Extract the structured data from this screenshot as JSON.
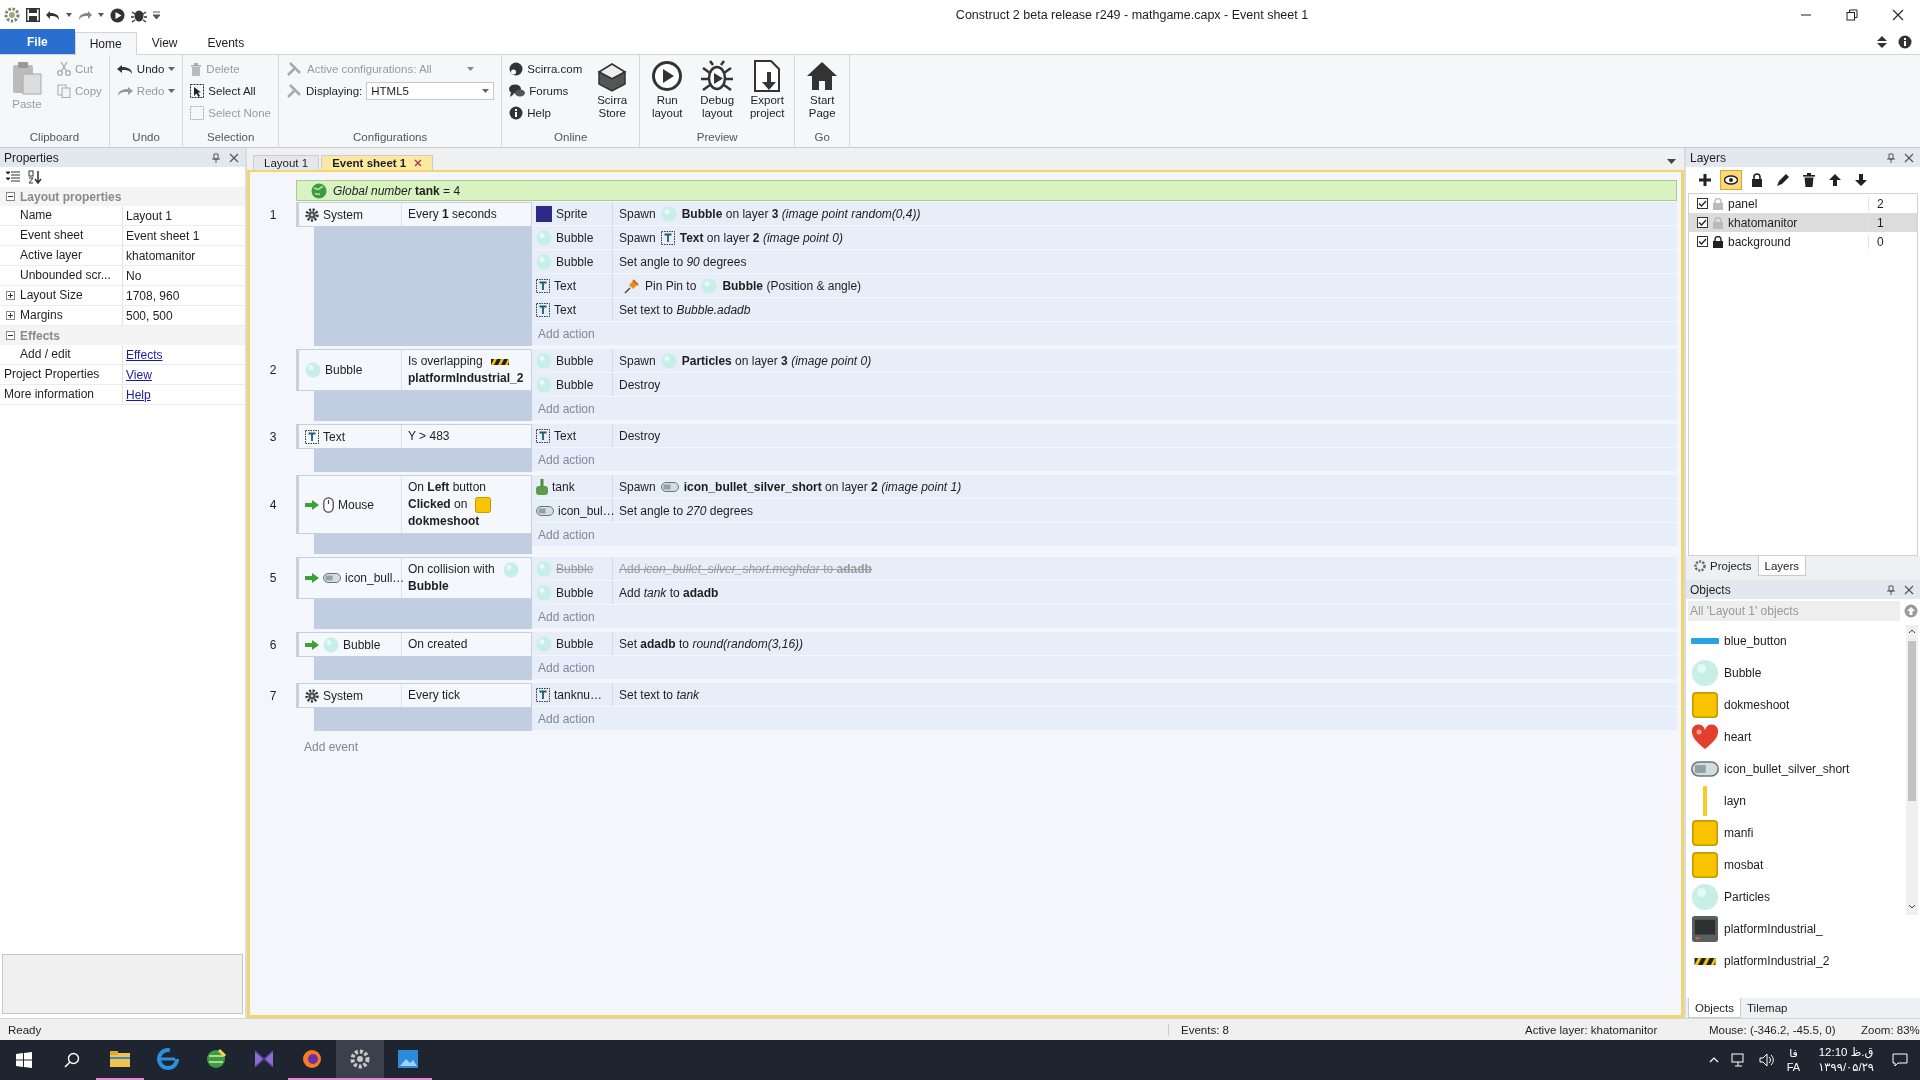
{
  "window": {
    "title": "Construct 2 beta release r249 - mathgame.capx - Event sheet 1"
  },
  "ribbon_tabs": [
    {
      "label": "File",
      "kind": "file",
      "selected": false
    },
    {
      "label": "Home",
      "kind": "tab",
      "selected": true
    },
    {
      "label": "View",
      "kind": "tab",
      "selected": false
    },
    {
      "label": "Events",
      "kind": "tab",
      "selected": false
    }
  ],
  "ribbon_groups": [
    {
      "label": "Clipboard",
      "buttons": [
        {
          "kind": "big",
          "label": "Paste",
          "disabled": true
        },
        {
          "kind": "small",
          "label": "Cut",
          "disabled": true
        },
        {
          "kind": "small",
          "label": "Copy",
          "disabled": true
        }
      ]
    },
    {
      "label": "Undo",
      "buttons": [
        {
          "kind": "split",
          "label": "Undo",
          "disabled": false
        },
        {
          "kind": "split",
          "label": "Redo",
          "disabled": true
        }
      ]
    },
    {
      "label": "Selection",
      "buttons": [
        {
          "kind": "small",
          "label": "Delete",
          "disabled": true
        },
        {
          "kind": "small",
          "label": "Select All",
          "disabled": false
        },
        {
          "kind": "small",
          "label": "Select None",
          "disabled": true
        }
      ]
    },
    {
      "label": "Configurations",
      "buttons": [
        {
          "kind": "combo",
          "label": "Active configurations: All",
          "disabled": true
        },
        {
          "kind": "select",
          "label": "Displaying:",
          "value": "HTML5",
          "disabled": false
        }
      ]
    },
    {
      "label": "Online",
      "buttons": [
        {
          "kind": "small",
          "label": "Scirra.com",
          "disabled": false
        },
        {
          "kind": "small",
          "label": "Forums",
          "disabled": false
        },
        {
          "kind": "small",
          "label": "Help",
          "disabled": false
        },
        {
          "kind": "big",
          "label": "Scirra Store",
          "disabled": false
        }
      ]
    },
    {
      "label": "Preview",
      "buttons": [
        {
          "kind": "big",
          "label": "Run layout",
          "disabled": false
        },
        {
          "kind": "big",
          "label": "Debug layout",
          "disabled": false
        },
        {
          "kind": "big",
          "label": "Export project",
          "disabled": false
        }
      ]
    },
    {
      "label": "Go",
      "buttons": [
        {
          "kind": "big",
          "label": "Start Page",
          "disabled": false
        }
      ]
    }
  ],
  "properties": {
    "title": "Properties",
    "sections": [
      {
        "title": "Layout properties",
        "expanded": true,
        "rows": [
          {
            "kind": "value",
            "name": "Name",
            "value": "Layout 1"
          },
          {
            "kind": "value",
            "name": "Event sheet",
            "value": "Event sheet 1"
          },
          {
            "kind": "value",
            "name": "Active layer",
            "value": "khatomanitor"
          },
          {
            "kind": "value",
            "name": "Unbounded scr...",
            "value": "No"
          },
          {
            "kind": "group",
            "name": "Layout Size",
            "value": "1708, 960",
            "expanded": false
          },
          {
            "kind": "group",
            "name": "Margins",
            "value": "500, 500",
            "expanded": false
          }
        ]
      },
      {
        "title": "Effects",
        "expanded": true,
        "rows": [
          {
            "kind": "link",
            "name": "Add / edit",
            "value": "Effects"
          }
        ]
      }
    ],
    "links": [
      {
        "name": "Project Properties",
        "value": "View"
      },
      {
        "name": "More information",
        "value": "Help"
      }
    ]
  },
  "doc_tabs": [
    {
      "label": "Layout 1",
      "selected": false,
      "closable": false
    },
    {
      "label": "Event sheet 1",
      "selected": true,
      "closable": true
    }
  ],
  "event_sheet": {
    "global": "*Global number* **tank** = 4",
    "events": [
      {
        "number": "1",
        "conditions": [
          {
            "kind": "system",
            "object": "System",
            "trigger": false,
            "parts": [
              {
                "text": "Every **1** seconds"
              }
            ]
          }
        ],
        "actions": [
          {
            "kind": "sprite",
            "object": "Sprite",
            "disabled": false,
            "parts": [
              {
                "text": "Spawn"
              },
              {
                "kind": "bubble"
              },
              {
                "text": "**Bubble** on layer **3** *(image point random(0,4))*"
              }
            ]
          },
          {
            "kind": "bubble",
            "object": "Bubble",
            "disabled": false,
            "parts": [
              {
                "text": "Spawn"
              },
              {
                "kind": "text"
              },
              {
                "text": "**Text** on layer **2** *(image point 0)*"
              }
            ]
          },
          {
            "kind": "bubble",
            "object": "Bubble",
            "disabled": false,
            "parts": [
              {
                "text": "Set angle to *90* degrees"
              }
            ]
          },
          {
            "kind": "text",
            "object": "Text",
            "disabled": false,
            "parts": [
              {
                "kind": "pin"
              },
              {
                "text": "Pin Pin to"
              },
              {
                "kind": "bubble"
              },
              {
                "text": "**Bubble** (Position & angle)"
              }
            ]
          },
          {
            "kind": "text",
            "object": "Text",
            "disabled": false,
            "parts": [
              {
                "text": "Set text to *Bubble.adadb*"
              }
            ]
          }
        ],
        "add_action": "Add action"
      },
      {
        "number": "2",
        "conditions": [
          {
            "kind": "bubble",
            "object": "Bubble",
            "trigger": false,
            "parts": [
              {
                "text": "Is overlapping"
              },
              {
                "kind": "stripe"
              },
              {
                "text": "**platformIndustrial_2**"
              }
            ]
          }
        ],
        "actions": [
          {
            "kind": "bubble",
            "object": "Bubble",
            "disabled": false,
            "parts": [
              {
                "text": "Spawn"
              },
              {
                "kind": "bubble"
              },
              {
                "text": "**Particles** on layer **3** *(image point 0)*"
              }
            ]
          },
          {
            "kind": "bubble",
            "object": "Bubble",
            "disabled": false,
            "parts": [
              {
                "text": "Destroy"
              }
            ]
          }
        ],
        "add_action": "Add action"
      },
      {
        "number": "3",
        "conditions": [
          {
            "kind": "text",
            "object": "Text",
            "trigger": false,
            "parts": [
              {
                "text": "Y > 483"
              }
            ]
          }
        ],
        "actions": [
          {
            "kind": "text",
            "object": "Text",
            "disabled": false,
            "parts": [
              {
                "text": "Destroy"
              }
            ]
          }
        ],
        "add_action": "Add action"
      },
      {
        "number": "4",
        "conditions": [
          {
            "kind": "mouse",
            "object": "Mouse",
            "trigger": true,
            "parts": [
              {
                "text": "On **Left** button"
              },
              {
                "text": "**Clicked** on"
              },
              {
                "kind": "block"
              },
              {
                "text": "**dokmeshoot**"
              }
            ]
          }
        ],
        "actions": [
          {
            "kind": "tank",
            "object": "tank",
            "disabled": false,
            "parts": [
              {
                "text": "Spawn"
              },
              {
                "kind": "bullet"
              },
              {
                "text": "**icon_bullet_silver_short** on layer **2** *(image point 1)*"
              }
            ]
          },
          {
            "kind": "bullet",
            "object": "icon_bul…",
            "disabled": false,
            "parts": [
              {
                "text": "Set angle to *270* degrees"
              }
            ]
          }
        ],
        "add_action": "Add action"
      },
      {
        "number": "5",
        "conditions": [
          {
            "kind": "bullet",
            "object": "icon_bull…",
            "trigger": true,
            "parts": [
              {
                "text": "On collision with"
              },
              {
                "kind": "bubble"
              },
              {
                "text": "**Bubble**"
              }
            ]
          }
        ],
        "actions": [
          {
            "kind": "bubble",
            "object": "Bubble",
            "disabled": true,
            "parts": [
              {
                "text": "Add *icon_bullet_silver_short.meghdar* to **adadb**"
              }
            ]
          },
          {
            "kind": "bubble",
            "object": "Bubble",
            "disabled": false,
            "parts": [
              {
                "text": "Add *tank* to **adadb**"
              }
            ]
          }
        ],
        "add_action": "Add action"
      },
      {
        "number": "6",
        "conditions": [
          {
            "kind": "bubble",
            "object": "Bubble",
            "trigger": true,
            "parts": [
              {
                "text": "On created"
              }
            ]
          }
        ],
        "actions": [
          {
            "kind": "bubble",
            "object": "Bubble",
            "disabled": false,
            "parts": [
              {
                "text": "Set **adadb** to *round(random(3,16))*"
              }
            ]
          }
        ],
        "add_action": "Add action"
      },
      {
        "number": "7",
        "conditions": [
          {
            "kind": "system",
            "object": "System",
            "trigger": false,
            "parts": [
              {
                "text": "Every tick"
              }
            ]
          }
        ],
        "actions": [
          {
            "kind": "text",
            "object": "tanknu…",
            "disabled": false,
            "parts": [
              {
                "text": "Set text to *tank*"
              }
            ]
          }
        ],
        "add_action": "Add action"
      }
    ],
    "add_event": "Add event"
  },
  "layers_panel": {
    "title": "Layers",
    "tools": [
      {
        "on": false
      },
      {
        "on": true
      },
      {
        "on": false
      },
      {
        "on": false
      },
      {
        "on": false
      },
      {
        "on": false
      },
      {
        "on": false
      }
    ],
    "layers": [
      {
        "name": "panel",
        "number": "2",
        "visible": true,
        "locked": false,
        "selected": false
      },
      {
        "name": "khatomanitor",
        "number": "1",
        "visible": true,
        "locked": false,
        "selected": true
      },
      {
        "name": "background",
        "number": "0",
        "visible": true,
        "locked": true,
        "selected": false
      }
    ],
    "tabs": [
      {
        "label": "Projects",
        "selected": false
      },
      {
        "label": "Layers",
        "selected": true
      }
    ]
  },
  "objects_panel": {
    "title": "Objects",
    "placeholder": "All 'Layout 1' objects",
    "objects": [
      {
        "name": "blue_button",
        "kind": "bar"
      },
      {
        "name": "Bubble",
        "kind": "bubble"
      },
      {
        "name": "dokmeshoot",
        "kind": "block"
      },
      {
        "name": "heart",
        "kind": "heart"
      },
      {
        "name": "icon_bullet_silver_short",
        "kind": "bullet"
      },
      {
        "name": "layn",
        "kind": "line"
      },
      {
        "name": "manfi",
        "kind": "block"
      },
      {
        "name": "mosbat",
        "kind": "block"
      },
      {
        "name": "Particles",
        "kind": "bubble"
      },
      {
        "name": "platformIndustrial_",
        "kind": "monitor"
      },
      {
        "name": "platformIndustrial_2",
        "kind": "stripe"
      }
    ],
    "tabs": [
      {
        "label": "Objects",
        "selected": true
      },
      {
        "label": "Tilemap",
        "selected": false
      }
    ]
  },
  "status_bar": {
    "left": "Ready",
    "events": "Events: 8",
    "layer": "Active layer: khatomanitor",
    "mouse": "Mouse: (-346.2, -45.5, 0)",
    "zoom": "Zoom: 83%"
  },
  "taskbar": {
    "apps": [
      {
        "running": true,
        "selected": false
      },
      {
        "running": false,
        "selected": false
      },
      {
        "running": false,
        "selected": false
      },
      {
        "running": false,
        "selected": false
      },
      {
        "running": true,
        "selected": false
      },
      {
        "running": true,
        "selected": true
      },
      {
        "running": true,
        "selected": false
      }
    ],
    "lang_top": "فا",
    "lang": "FA",
    "time": "ق.ظ 12:10",
    "date": "۱۳۹۹/۰۵/۲۹"
  }
}
